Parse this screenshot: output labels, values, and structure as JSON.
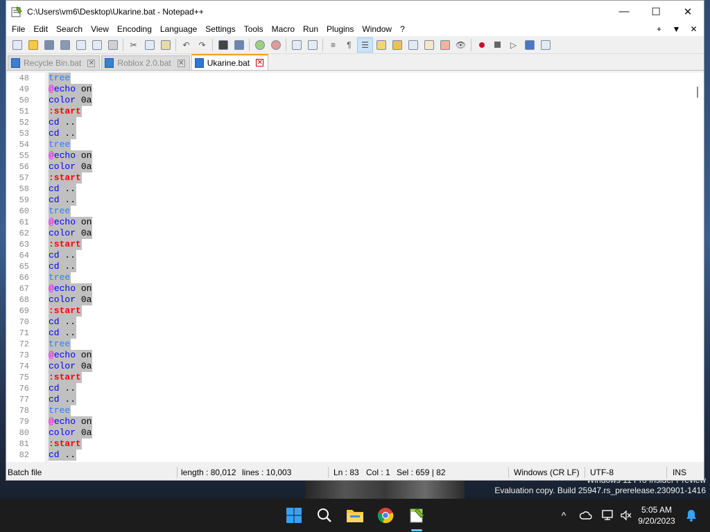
{
  "window": {
    "title": "C:\\Users\\vm6\\Desktop\\Ukarine.bat - Notepad++",
    "minimize": "—",
    "maximize": "☐",
    "close": "✕"
  },
  "menu": {
    "items": [
      "File",
      "Edit",
      "Search",
      "View",
      "Encoding",
      "Language",
      "Settings",
      "Tools",
      "Macro",
      "Run",
      "Plugins",
      "Window",
      "?"
    ],
    "right": [
      "+",
      "▼",
      "✕"
    ]
  },
  "tabs": [
    {
      "label": "Recycle Bin.bat",
      "active": false
    },
    {
      "label": "Roblox 2.0.bat",
      "active": false
    },
    {
      "label": "Ukarine.bat",
      "active": true
    }
  ],
  "editor": {
    "lines": [
      {
        "n": "48",
        "tokens": [
          [
            "tree",
            "tree"
          ]
        ]
      },
      {
        "n": "49",
        "tokens": [
          [
            "at",
            "@"
          ],
          [
            "kw",
            "echo"
          ],
          [
            "plain",
            " on"
          ]
        ]
      },
      {
        "n": "50",
        "tokens": [
          [
            "kw",
            "color"
          ],
          [
            "plain",
            " 0a"
          ]
        ]
      },
      {
        "n": "51",
        "tokens": [
          [
            "lbl",
            ":start"
          ]
        ]
      },
      {
        "n": "52",
        "tokens": [
          [
            "kw",
            "cd"
          ],
          [
            "plain",
            " .."
          ]
        ]
      },
      {
        "n": "53",
        "tokens": [
          [
            "kw",
            "cd"
          ],
          [
            "plain",
            " .."
          ]
        ]
      },
      {
        "n": "54",
        "tokens": [
          [
            "tree",
            "tree"
          ]
        ]
      },
      {
        "n": "55",
        "tokens": [
          [
            "at",
            "@"
          ],
          [
            "kw",
            "echo"
          ],
          [
            "plain",
            " on"
          ]
        ]
      },
      {
        "n": "56",
        "tokens": [
          [
            "kw",
            "color"
          ],
          [
            "plain",
            " 0a"
          ]
        ]
      },
      {
        "n": "57",
        "tokens": [
          [
            "lbl",
            ":start"
          ]
        ]
      },
      {
        "n": "58",
        "tokens": [
          [
            "kw",
            "cd"
          ],
          [
            "plain",
            " .."
          ]
        ]
      },
      {
        "n": "59",
        "tokens": [
          [
            "kw",
            "cd"
          ],
          [
            "plain",
            " .."
          ]
        ]
      },
      {
        "n": "60",
        "tokens": [
          [
            "tree",
            "tree"
          ]
        ]
      },
      {
        "n": "61",
        "tokens": [
          [
            "at",
            "@"
          ],
          [
            "kw",
            "echo"
          ],
          [
            "plain",
            " on"
          ]
        ]
      },
      {
        "n": "62",
        "tokens": [
          [
            "kw",
            "color"
          ],
          [
            "plain",
            " 0a"
          ]
        ]
      },
      {
        "n": "63",
        "tokens": [
          [
            "lbl",
            ":start"
          ]
        ]
      },
      {
        "n": "64",
        "tokens": [
          [
            "kw",
            "cd"
          ],
          [
            "plain",
            " .."
          ]
        ]
      },
      {
        "n": "65",
        "tokens": [
          [
            "kw",
            "cd"
          ],
          [
            "plain",
            " .."
          ]
        ]
      },
      {
        "n": "66",
        "tokens": [
          [
            "tree",
            "tree"
          ]
        ]
      },
      {
        "n": "67",
        "tokens": [
          [
            "at",
            "@"
          ],
          [
            "kw",
            "echo"
          ],
          [
            "plain",
            " on"
          ]
        ]
      },
      {
        "n": "68",
        "tokens": [
          [
            "kw",
            "color"
          ],
          [
            "plain",
            " 0a"
          ]
        ]
      },
      {
        "n": "69",
        "tokens": [
          [
            "lbl",
            ":start"
          ]
        ]
      },
      {
        "n": "70",
        "tokens": [
          [
            "kw",
            "cd"
          ],
          [
            "plain",
            " .."
          ]
        ]
      },
      {
        "n": "71",
        "tokens": [
          [
            "kw",
            "cd"
          ],
          [
            "plain",
            " .."
          ]
        ]
      },
      {
        "n": "72",
        "tokens": [
          [
            "tree",
            "tree"
          ]
        ]
      },
      {
        "n": "73",
        "tokens": [
          [
            "at",
            "@"
          ],
          [
            "kw",
            "echo"
          ],
          [
            "plain",
            " on"
          ]
        ]
      },
      {
        "n": "74",
        "tokens": [
          [
            "kw",
            "color"
          ],
          [
            "plain",
            " 0a"
          ]
        ]
      },
      {
        "n": "75",
        "tokens": [
          [
            "lbl",
            ":start"
          ]
        ]
      },
      {
        "n": "76",
        "tokens": [
          [
            "kw",
            "cd"
          ],
          [
            "plain",
            " .."
          ]
        ]
      },
      {
        "n": "77",
        "tokens": [
          [
            "kw",
            "cd"
          ],
          [
            "plain",
            " .."
          ]
        ]
      },
      {
        "n": "78",
        "tokens": [
          [
            "tree",
            "tree"
          ]
        ]
      },
      {
        "n": "79",
        "tokens": [
          [
            "at",
            "@"
          ],
          [
            "kw",
            "echo"
          ],
          [
            "plain",
            " on"
          ]
        ]
      },
      {
        "n": "80",
        "tokens": [
          [
            "kw",
            "color"
          ],
          [
            "plain",
            " 0a"
          ]
        ]
      },
      {
        "n": "81",
        "tokens": [
          [
            "lbl",
            ":start"
          ]
        ]
      },
      {
        "n": "82",
        "tokens": [
          [
            "kw",
            "cd"
          ],
          [
            "plain",
            " .."
          ]
        ]
      }
    ]
  },
  "status": {
    "language": "Batch file",
    "length": "length : 80,012",
    "lines": "lines : 10,003",
    "ln": "Ln : 83",
    "col": "Col : 1",
    "sel": "Sel : 659 | 82",
    "eol": "Windows (CR LF)",
    "encoding": "UTF-8",
    "mode": "INS"
  },
  "desktop": {
    "watermark_line1": "Windows 11 Pro Insider Preview",
    "watermark_line2": "Evaluation copy. Build 25947.rs_prerelease.230901-1416"
  },
  "taskbar": {
    "time": "5:05 AM",
    "date": "9/20/2023",
    "tray_chevron": "^"
  },
  "colors": {
    "tree": "#2a7fff",
    "at": "#ff00ff",
    "keyword": "#0000ff",
    "label": "#ff0000",
    "selection": "#c0c0c0",
    "active_tab_accent": "#f5a300"
  }
}
